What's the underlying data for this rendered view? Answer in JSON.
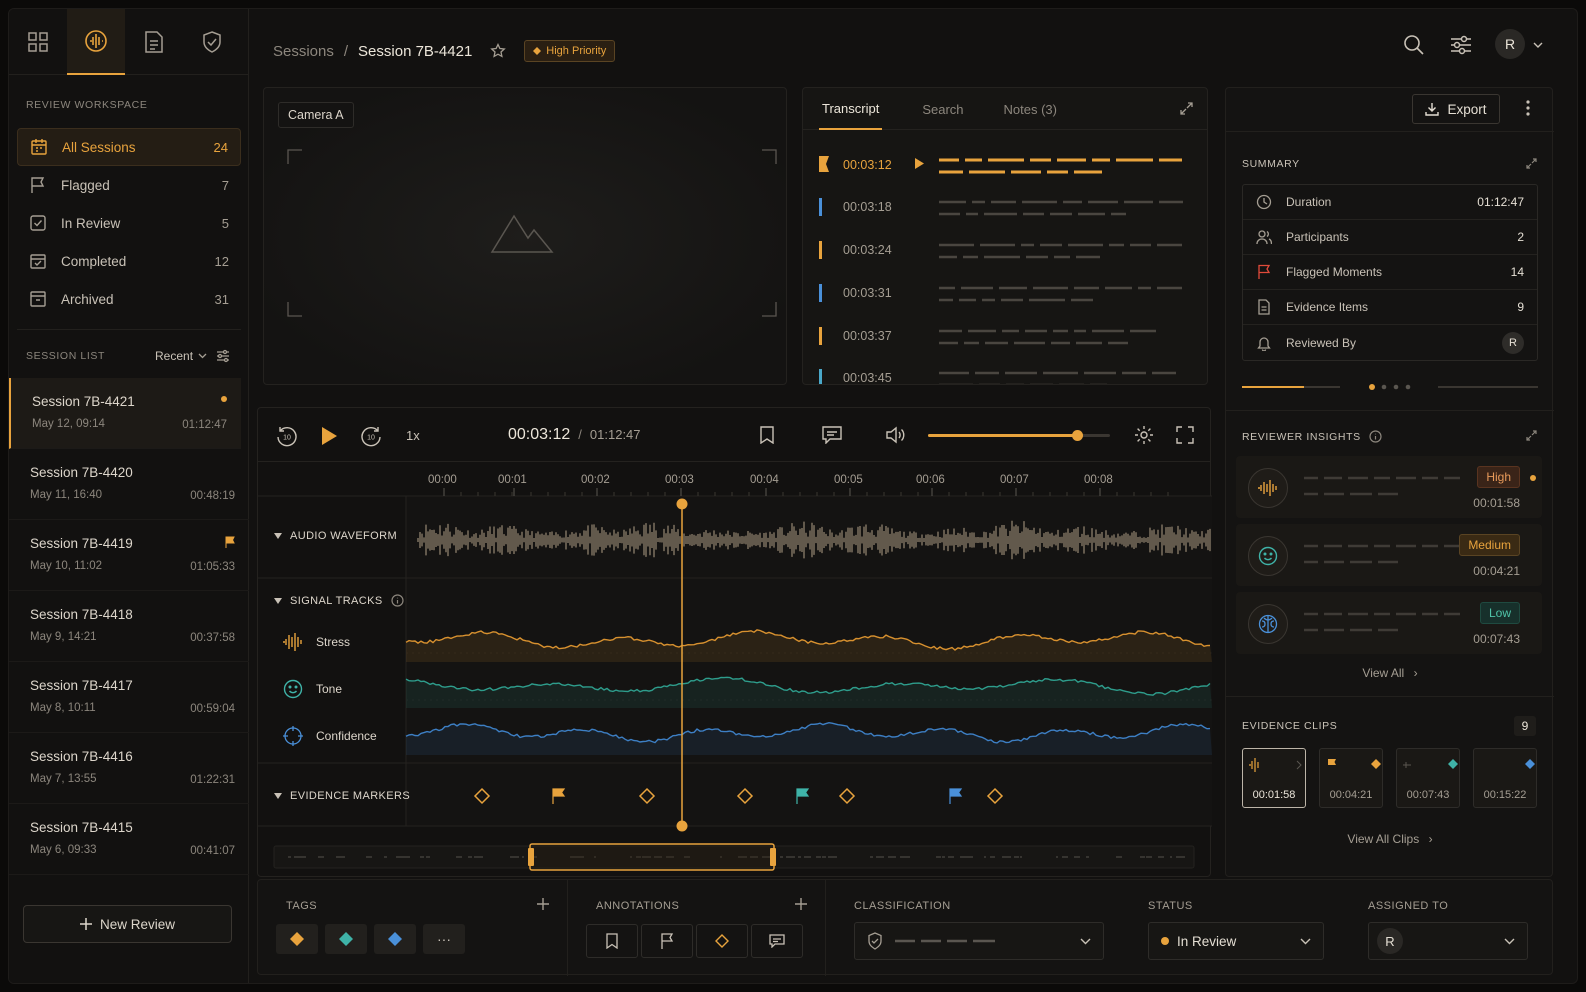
{
  "nav_icons": [
    "grid-icon",
    "audio-scan-icon",
    "document-icon",
    "shield-check-icon"
  ],
  "workspace_label": "REVIEW WORKSPACE",
  "workspace_items": [
    {
      "label": "All Sessions",
      "count": "24",
      "icon": "grid-calendar-icon"
    },
    {
      "label": "Flagged",
      "count": "7",
      "icon": "flag-icon"
    },
    {
      "label": "In Review",
      "count": "5",
      "icon": "check-shield-icon"
    },
    {
      "label": "Completed",
      "count": "12",
      "icon": "calendar-check-icon"
    },
    {
      "label": "Archived",
      "count": "31",
      "icon": "archive-icon"
    }
  ],
  "session_list": {
    "label": "SESSION LIST",
    "sort": "Recent",
    "items": [
      {
        "title": "Session 7B-4421",
        "date": "May 12, 09:14",
        "duration": "01:12:47"
      },
      {
        "title": "Session 7B-4420",
        "date": "May 11, 16:40",
        "duration": "00:48:19"
      },
      {
        "title": "Session 7B-4419",
        "date": "May 10, 11:02",
        "duration": "01:05:33"
      },
      {
        "title": "Session 7B-4418",
        "date": "May 9, 14:21",
        "duration": "00:37:58"
      },
      {
        "title": "Session 7B-4417",
        "date": "May 8, 10:11",
        "duration": "00:59:04"
      },
      {
        "title": "Session 7B-4416",
        "date": "May 7, 13:55",
        "duration": "01:22:31"
      },
      {
        "title": "Session 7B-4415",
        "date": "May 6, 09:33",
        "duration": "00:41:07"
      }
    ]
  },
  "new_review": "New Review",
  "breadcrumb": {
    "root": "Sessions",
    "sep": "/",
    "current": "Session 7B-4421",
    "priority": "High Priority"
  },
  "user_initial": "R",
  "video": {
    "camera": "Camera A"
  },
  "transcript": {
    "tabs": [
      "Transcript",
      "Search",
      "Notes (3)"
    ],
    "rows": [
      {
        "time": "00:03:12",
        "color": "#e8a33d"
      },
      {
        "time": "00:03:18",
        "color": "#4a90d9"
      },
      {
        "time": "00:03:24",
        "color": "#e8a33d"
      },
      {
        "time": "00:03:31",
        "color": "#4a90d9"
      },
      {
        "time": "00:03:37",
        "color": "#e8a33d"
      },
      {
        "time": "00:03:45",
        "color": "#4aa8c9"
      }
    ]
  },
  "player": {
    "speed": "1x",
    "current": "00:03:12",
    "sep": "/",
    "total": "01:12:47",
    "volume": 0.82,
    "ticks": [
      "00:00",
      "00:01",
      "00:02",
      "00:03",
      "00:04",
      "00:05",
      "00:06",
      "00:07",
      "00:08"
    ],
    "audio_label": "AUDIO WAVEFORM",
    "signal_label": "SIGNAL TRACKS",
    "tracks": [
      "Stress",
      "Tone",
      "Confidence"
    ],
    "markers_label": "EVIDENCE MARKERS"
  },
  "right": {
    "export": "Export",
    "summary_label": "SUMMARY",
    "summary": [
      {
        "label": "Duration",
        "value": "01:12:47",
        "icon": "clock-icon"
      },
      {
        "label": "Participants",
        "value": "2",
        "icon": "users-icon"
      },
      {
        "label": "Flagged Moments",
        "value": "14",
        "icon": "flag-icon"
      },
      {
        "label": "Evidence Items",
        "value": "9",
        "icon": "file-icon"
      },
      {
        "label": "Reviewed By",
        "value": "R",
        "icon": "bell-icon"
      }
    ],
    "insights_label": "REVIEWER INSIGHTS",
    "insights": [
      {
        "level": "High",
        "time": "00:01:58",
        "icon": "waveform-icon"
      },
      {
        "level": "Medium",
        "time": "00:04:21",
        "icon": "smiley-icon"
      },
      {
        "level": "Low",
        "time": "00:07:43",
        "icon": "brain-icon"
      }
    ],
    "view_all": "View All",
    "clips_label": "EVIDENCE CLIPS",
    "clips_count": "9",
    "clips": [
      "00:01:58",
      "00:04:21",
      "00:07:43",
      "00:15:22"
    ],
    "view_all_clips": "View All Clips"
  },
  "bottom": {
    "tags_label": "TAGS",
    "annotations_label": "ANNOTATIONS",
    "classification_label": "CLASSIFICATION",
    "status_label": "STATUS",
    "status_value": "In Review",
    "assigned_label": "ASSIGNED TO",
    "assigned_initial": "R"
  },
  "colors": {
    "accent": "#e8a33d",
    "teal": "#3fb3a8",
    "blue": "#4a90d9",
    "stress": "#d8912f",
    "tone": "#2e9d8c",
    "confidence": "#3d7fc4"
  }
}
